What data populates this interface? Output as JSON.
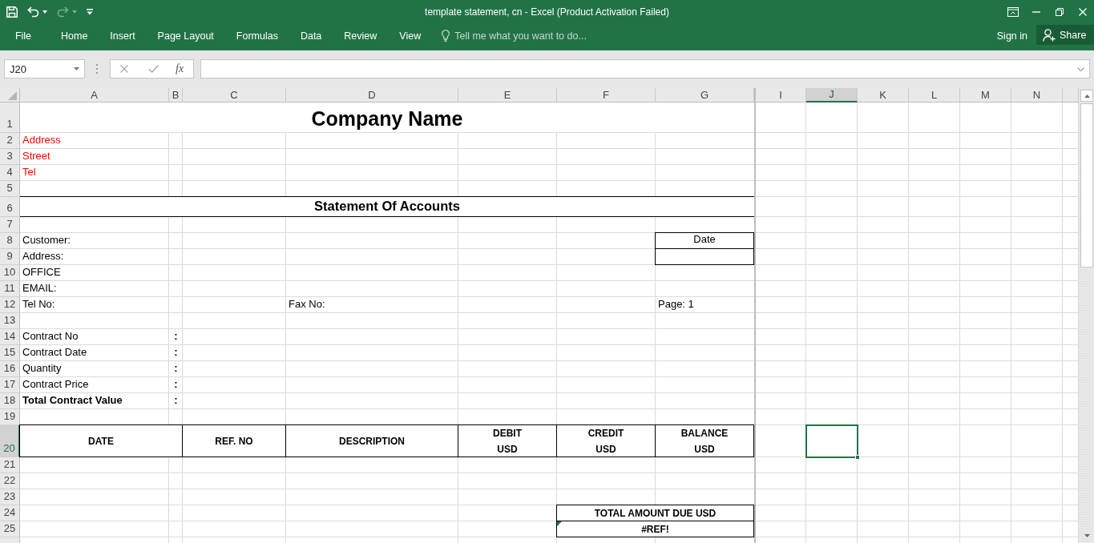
{
  "window": {
    "title": "template statement, cn - Excel (Product Activation Failed)"
  },
  "quick_access": [
    {
      "kind": "save",
      "disabled": false
    },
    {
      "kind": "undo",
      "disabled": false
    },
    {
      "kind": "redo",
      "disabled": true
    },
    {
      "kind": "customize",
      "disabled": false
    }
  ],
  "ribbon": {
    "file_tab": "File",
    "tabs": [
      {
        "label": "Home",
        "selected": false
      },
      {
        "label": "Insert",
        "selected": false
      },
      {
        "label": "Page Layout",
        "selected": false
      },
      {
        "label": "Formulas",
        "selected": false
      },
      {
        "label": "Data",
        "selected": false
      },
      {
        "label": "Review",
        "selected": false
      },
      {
        "label": "View",
        "selected": false
      }
    ],
    "tell_me": {
      "placeholder": "Tell me what you want to do..."
    },
    "sign_in": "Sign in",
    "share": "Share"
  },
  "formula_bar": {
    "name_box": "J20",
    "function_label": "fx"
  },
  "sheet": {
    "columns": [
      {
        "label": "A",
        "selected": false
      },
      {
        "label": "B",
        "selected": false
      },
      {
        "label": "C",
        "selected": false
      },
      {
        "label": "D",
        "selected": false
      },
      {
        "label": "E",
        "selected": false
      },
      {
        "label": "F",
        "selected": false
      },
      {
        "label": "G",
        "selected": false
      },
      {
        "label": "I",
        "selected": false
      },
      {
        "label": "J",
        "selected": true
      },
      {
        "label": "K",
        "selected": false
      },
      {
        "label": "L",
        "selected": false
      },
      {
        "label": "M",
        "selected": false
      },
      {
        "label": "N",
        "selected": false
      }
    ],
    "rows": [
      {
        "label": "1",
        "selected": false
      },
      {
        "label": "2",
        "selected": false
      },
      {
        "label": "3",
        "selected": false
      },
      {
        "label": "4",
        "selected": false
      },
      {
        "label": "5",
        "selected": false
      },
      {
        "label": "6",
        "selected": false
      },
      {
        "label": "7",
        "selected": false
      },
      {
        "label": "8",
        "selected": false
      },
      {
        "label": "9",
        "selected": false
      },
      {
        "label": "10",
        "selected": false
      },
      {
        "label": "11",
        "selected": false
      },
      {
        "label": "12",
        "selected": false
      },
      {
        "label": "13",
        "selected": false
      },
      {
        "label": "14",
        "selected": false
      },
      {
        "label": "15",
        "selected": false
      },
      {
        "label": "16",
        "selected": false
      },
      {
        "label": "17",
        "selected": false
      },
      {
        "label": "18",
        "selected": false
      },
      {
        "label": "19",
        "selected": false
      },
      {
        "label": "20",
        "selected": true
      },
      {
        "label": "21",
        "selected": false
      },
      {
        "label": "22",
        "selected": false
      },
      {
        "label": "23",
        "selected": false
      },
      {
        "label": "24",
        "selected": false
      },
      {
        "label": "25",
        "selected": false
      }
    ],
    "company": {
      "name": "Company Name",
      "details": [
        "Address",
        "Street",
        "Tel"
      ]
    },
    "statement_title": "Statement Of Accounts",
    "customer_fields": [
      "Customer:",
      "Address:",
      "OFFICE",
      "EMAIL:",
      "Tel No:"
    ],
    "fax_label": "Fax No:",
    "date_box": {
      "label": "Date"
    },
    "page_label": "Page: 1",
    "contract_fields": [
      {
        "label": "Contract No",
        "separator": ":",
        "kind": "plain"
      },
      {
        "label": "Contract Date",
        "separator": ":",
        "kind": "plain"
      },
      {
        "label": "Quantity",
        "separator": ":",
        "kind": "plain"
      },
      {
        "label": "Contract Price",
        "separator": ":",
        "kind": "plain"
      },
      {
        "label": "Total Contract Value",
        "separator": ":",
        "kind": "total"
      }
    ],
    "ledger_columns": [
      {
        "label": "DATE"
      },
      {
        "label": "REF. NO"
      },
      {
        "label": "DESCRIPTION"
      },
      {
        "label": "DEBIT",
        "unit": "USD"
      },
      {
        "label": "CREDIT",
        "unit": "USD"
      },
      {
        "label": "BALANCE",
        "unit": "USD"
      }
    ],
    "total_due": {
      "label": "TOTAL AMOUNT DUE USD",
      "value": "#REF!",
      "error_flag": true
    }
  }
}
